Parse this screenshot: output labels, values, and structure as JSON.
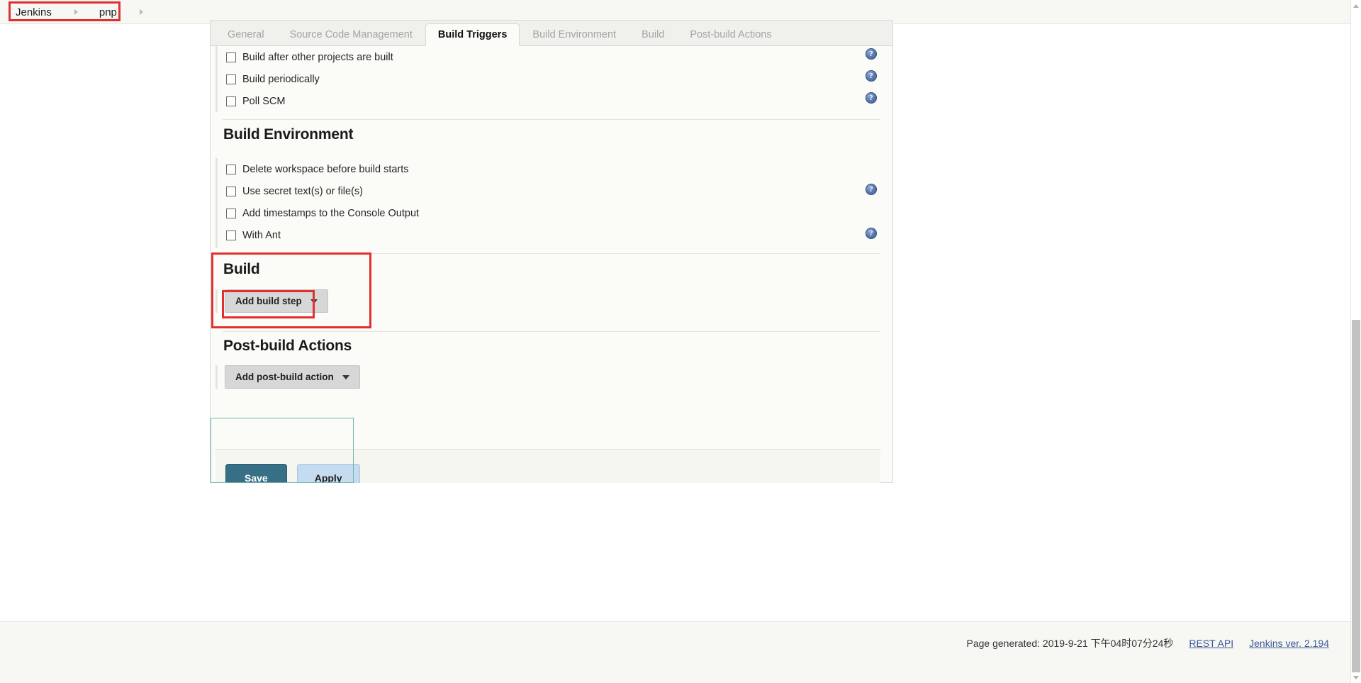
{
  "breadcrumb": {
    "items": [
      {
        "label": "Jenkins"
      },
      {
        "label": "pnp"
      }
    ]
  },
  "tabs": [
    {
      "label": "General",
      "active": false
    },
    {
      "label": "Source Code Management",
      "active": false
    },
    {
      "label": "Build Triggers",
      "active": true
    },
    {
      "label": "Build Environment",
      "active": false
    },
    {
      "label": "Build",
      "active": false
    },
    {
      "label": "Post-build Actions",
      "active": false
    }
  ],
  "build_triggers": {
    "checkboxes": [
      {
        "label": "Build after other projects are built",
        "checked": false,
        "help": true
      },
      {
        "label": "Build periodically",
        "checked": false,
        "help": true
      },
      {
        "label": "Poll SCM",
        "checked": false,
        "help": true
      }
    ]
  },
  "build_environment": {
    "title": "Build Environment",
    "checkboxes": [
      {
        "label": "Delete workspace before build starts",
        "checked": false,
        "help": false
      },
      {
        "label": "Use secret text(s) or file(s)",
        "checked": false,
        "help": true
      },
      {
        "label": "Add timestamps to the Console Output",
        "checked": false,
        "help": false
      },
      {
        "label": "With Ant",
        "checked": false,
        "help": true
      }
    ]
  },
  "build": {
    "title": "Build",
    "add_step_label": "Add build step"
  },
  "post_build": {
    "title": "Post-build Actions",
    "add_action_label": "Add post-build action"
  },
  "actions": {
    "save_label": "Save",
    "apply_label": "Apply"
  },
  "footer": {
    "generated": "Page generated: 2019-9-21 下午04时07分24秒",
    "rest_api": "REST API",
    "version": "Jenkins ver. 2.194"
  },
  "icons": {
    "help": "?"
  },
  "colors": {
    "annotation_red": "#e03030",
    "annotation_teal": "#6fb4b0",
    "save_button": "#376f86",
    "apply_button": "#c5dcf0",
    "help_icon": "#3f5f96"
  }
}
